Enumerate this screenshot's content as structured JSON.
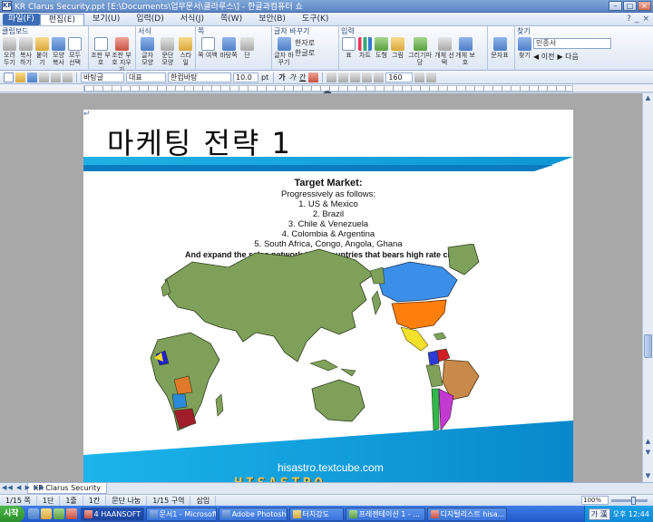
{
  "window": {
    "app_icon_text": "KR",
    "title": "KR Clarus Security.ppt [E:\\Documents\\업무문서\\클라루스\\] - 한글과컴퓨터 쇼",
    "controls": [
      "–",
      "□",
      "×"
    ]
  },
  "menu": {
    "items": [
      "파일(F)",
      "편집(E)",
      "보기(U)",
      "입력(D)",
      "서식(J)",
      "쪽(W)",
      "보안(B)",
      "도구(K)"
    ],
    "right": [
      "?",
      "_",
      "×"
    ]
  },
  "ribbon": {
    "groups": [
      {
        "label": "클립보드",
        "buttons": [
          "오려두기",
          "복사하기",
          "붙이기",
          "모양 복사",
          "모두 선택"
        ]
      },
      {
        "label": "",
        "buttons": [
          "조판 부호",
          "조판 부호 지우기"
        ]
      },
      {
        "label": "서식",
        "buttons": [
          "글자 모양",
          "문단 모양",
          "스타일"
        ]
      },
      {
        "label": "쪽",
        "buttons": [
          "쪽 여백",
          "바탕쪽",
          "단"
        ]
      },
      {
        "label": "글자 바꾸기",
        "buttons": [
          "글자 바꾸기"
        ],
        "list": [
          "한자로",
          "한글로"
        ]
      },
      {
        "label": "입력",
        "buttons": [
          "표",
          "차트",
          "도형",
          "그림",
          "그리기마당",
          "개체 선택",
          "개체 보호"
        ]
      },
      {
        "label": "",
        "buttons": [
          "문자표"
        ]
      },
      {
        "label": "찾기",
        "search_value": "민종서",
        "find_button": "찾기",
        "prev": "이전",
        "next": "다음"
      }
    ]
  },
  "toolbar": {
    "style": "바탕글",
    "lang": "대표",
    "font": "한컴바탕",
    "size": "10.0",
    "unit": "pt",
    "bold": "가",
    "italic": "가",
    "underline": "간",
    "zoom": "160"
  },
  "slide": {
    "corner_mark": "↵",
    "title": "마케팅  전략  1",
    "target_heading": "Target Market:",
    "intro": "Progressively as follows:",
    "items": [
      "1. US & Mexico",
      "2. Brazil",
      "3. Chile & Venezuela",
      "4. Colombia & Argentina",
      "5. South Africa, Congo, Angola, Ghana"
    ],
    "closing": "And expand the sales network to all countries that bears high rate crimes.",
    "footer_url": "hisastro.textcube.com"
  },
  "watermark": "HISASTRO",
  "colors": {
    "accent": "#1fb1e6",
    "accent_dark": "#0a7bbf",
    "map_land": "#7fa05a",
    "na_usa": "#ff7f0e",
    "na_canada": "#3c8fe8",
    "brazil": "#c88a4a",
    "argentina": "#c23ad0",
    "chile": "#30b84a"
  },
  "tabs": {
    "nav": "◀◀ ◀ ▶ ▶▶",
    "doc_tab": "KR Clarus Security"
  },
  "status": {
    "page": "1/15 쪽",
    "section": "1단",
    "line": "1줄",
    "column": "1칸",
    "paragraph": "문단 나눔",
    "zone": "1/15 구역",
    "mode": "삽입",
    "zoom": "100%"
  },
  "taskbar": {
    "start": "시작",
    "buttons": [
      "4 HAANSOFT ...",
      "문서1 - Microsoft ...",
      "Adobe Photoshop...",
      "터치강도",
      "프레젠테이션 1 - ...",
      "디지털리스트 hisa..."
    ],
    "ime": "가 漢",
    "clock": "오후 12:44"
  }
}
